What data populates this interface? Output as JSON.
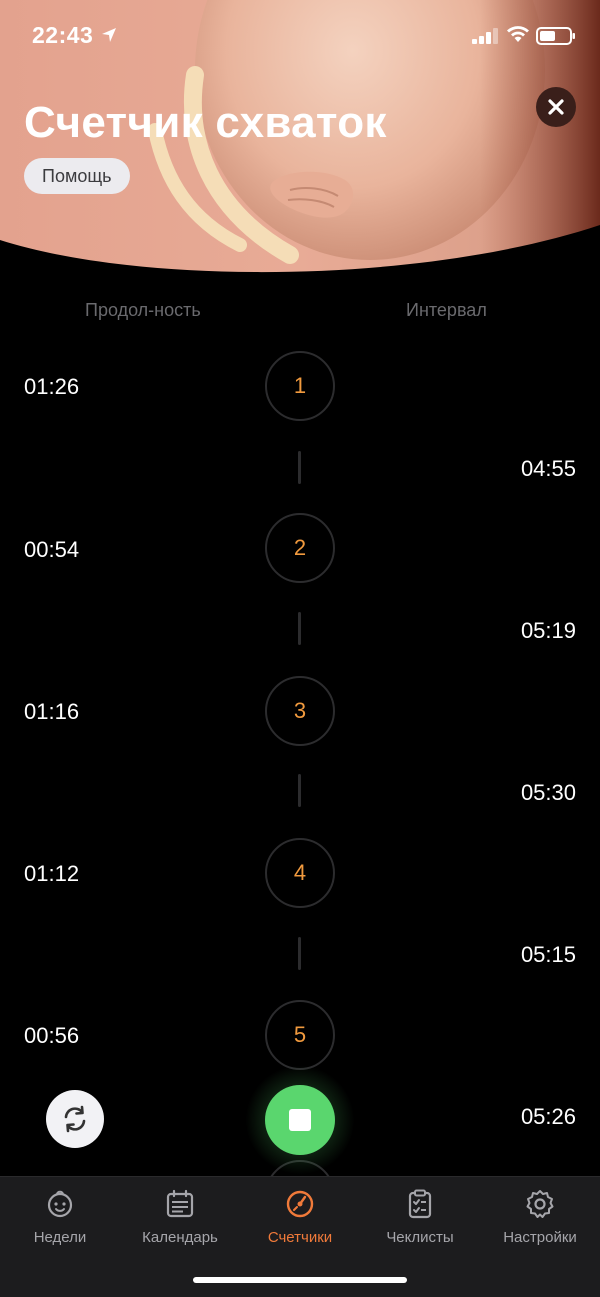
{
  "status_bar": {
    "time": "22:43"
  },
  "header": {
    "title": "Счетчик схваток",
    "help_label": "Помощь"
  },
  "columns": {
    "duration": "Продол-ность",
    "interval": "Интервал"
  },
  "contractions": [
    {
      "number": "1",
      "duration": "01:26",
      "interval": "04:55"
    },
    {
      "number": "2",
      "duration": "00:54",
      "interval": "05:19"
    },
    {
      "number": "3",
      "duration": "01:16",
      "interval": "05:30"
    },
    {
      "number": "4",
      "duration": "01:12",
      "interval": "05:15"
    },
    {
      "number": "5",
      "duration": "00:56",
      "interval": "05:26"
    }
  ],
  "tabbar": {
    "items": [
      {
        "label": "Недели",
        "icon": "baby-face-icon"
      },
      {
        "label": "Календарь",
        "icon": "calendar-icon"
      },
      {
        "label": "Счетчики",
        "icon": "stopwatch-icon",
        "active": true
      },
      {
        "label": "Чеклисты",
        "icon": "checklist-icon"
      },
      {
        "label": "Настройки",
        "icon": "gear-icon"
      }
    ]
  },
  "colors": {
    "accent_orange": "#f07a3a",
    "number_orange": "#f19a3e",
    "stop_green": "#5ad66e",
    "background": "#000000",
    "tabbar_bg": "#1c1c1e"
  }
}
